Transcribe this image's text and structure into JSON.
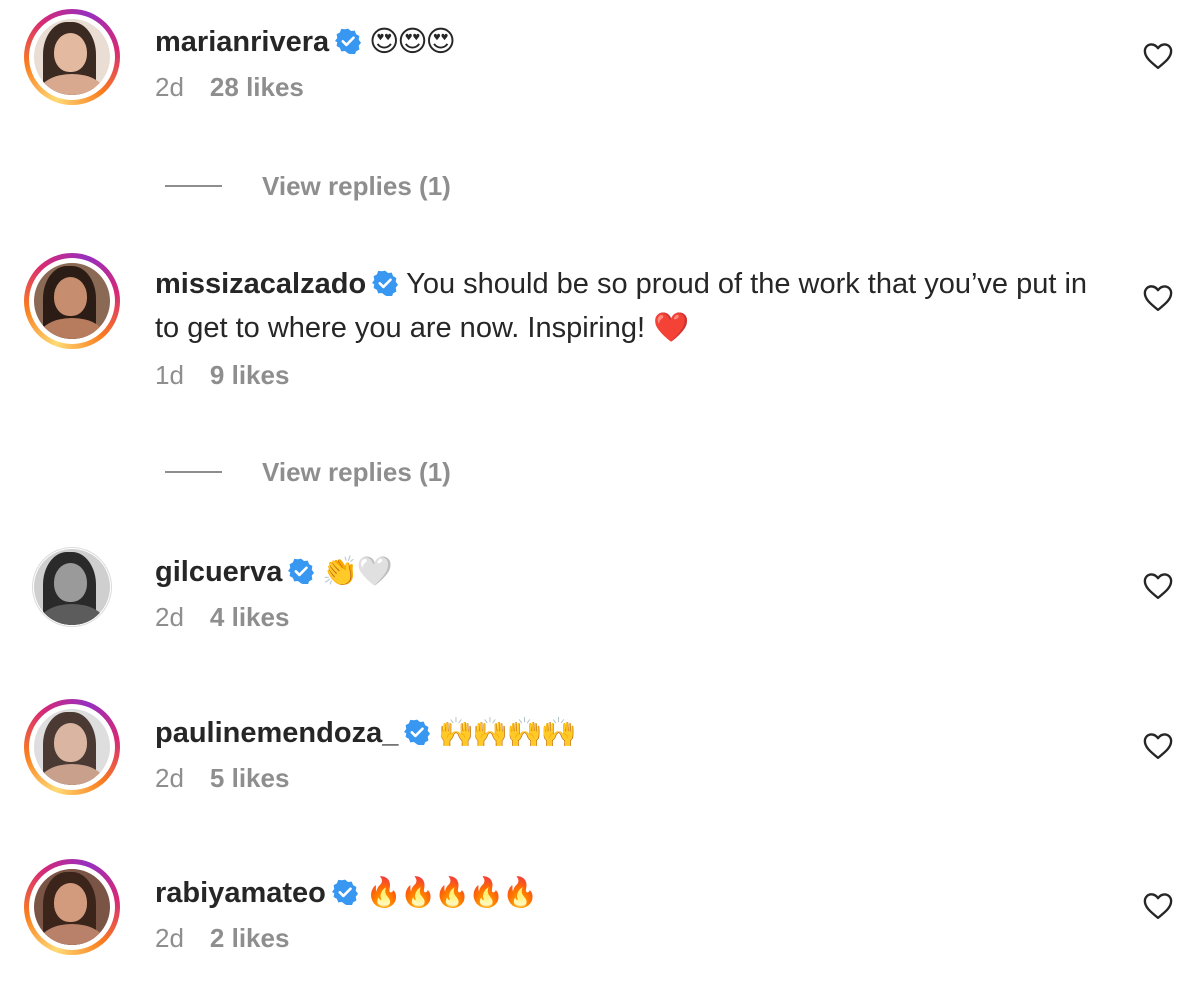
{
  "comments": [
    {
      "username": "marianrivera",
      "text": "😍😍😍",
      "time": "2d",
      "likes": "28 likes",
      "replies": "View replies (1)"
    },
    {
      "username": "missizacalzado",
      "text": "You should be so proud of the work that you’ve put in to get to where you are now. Inspiring! ❤️",
      "time": "1d",
      "likes": "9 likes",
      "replies": "View replies (1)"
    },
    {
      "username": "gilcuerva",
      "text": "👏🤍",
      "time": "2d",
      "likes": "4 likes"
    },
    {
      "username": "paulinemendoza_",
      "text": "🙌🙌🙌🙌",
      "time": "2d",
      "likes": "5 likes"
    },
    {
      "username": "rabiyamateo",
      "text": "🔥🔥🔥🔥🔥",
      "time": "2d",
      "likes": "2 likes"
    }
  ],
  "icons": {
    "verified": "verified-badge-icon",
    "like": "heart-outline-icon"
  },
  "colors": {
    "verified_blue": "#3897f0",
    "muted_text": "#8e8e8e",
    "primary_text": "#262626"
  }
}
